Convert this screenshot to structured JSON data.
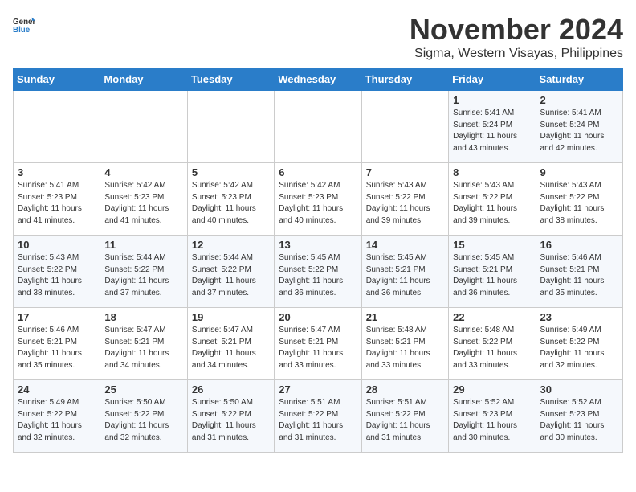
{
  "header": {
    "logo_general": "General",
    "logo_blue": "Blue",
    "month": "November 2024",
    "location": "Sigma, Western Visayas, Philippines"
  },
  "weekdays": [
    "Sunday",
    "Monday",
    "Tuesday",
    "Wednesday",
    "Thursday",
    "Friday",
    "Saturday"
  ],
  "weeks": [
    [
      {
        "day": "",
        "info": ""
      },
      {
        "day": "",
        "info": ""
      },
      {
        "day": "",
        "info": ""
      },
      {
        "day": "",
        "info": ""
      },
      {
        "day": "",
        "info": ""
      },
      {
        "day": "1",
        "info": "Sunrise: 5:41 AM\nSunset: 5:24 PM\nDaylight: 11 hours\nand 43 minutes."
      },
      {
        "day": "2",
        "info": "Sunrise: 5:41 AM\nSunset: 5:24 PM\nDaylight: 11 hours\nand 42 minutes."
      }
    ],
    [
      {
        "day": "3",
        "info": "Sunrise: 5:41 AM\nSunset: 5:23 PM\nDaylight: 11 hours\nand 41 minutes."
      },
      {
        "day": "4",
        "info": "Sunrise: 5:42 AM\nSunset: 5:23 PM\nDaylight: 11 hours\nand 41 minutes."
      },
      {
        "day": "5",
        "info": "Sunrise: 5:42 AM\nSunset: 5:23 PM\nDaylight: 11 hours\nand 40 minutes."
      },
      {
        "day": "6",
        "info": "Sunrise: 5:42 AM\nSunset: 5:23 PM\nDaylight: 11 hours\nand 40 minutes."
      },
      {
        "day": "7",
        "info": "Sunrise: 5:43 AM\nSunset: 5:22 PM\nDaylight: 11 hours\nand 39 minutes."
      },
      {
        "day": "8",
        "info": "Sunrise: 5:43 AM\nSunset: 5:22 PM\nDaylight: 11 hours\nand 39 minutes."
      },
      {
        "day": "9",
        "info": "Sunrise: 5:43 AM\nSunset: 5:22 PM\nDaylight: 11 hours\nand 38 minutes."
      }
    ],
    [
      {
        "day": "10",
        "info": "Sunrise: 5:43 AM\nSunset: 5:22 PM\nDaylight: 11 hours\nand 38 minutes."
      },
      {
        "day": "11",
        "info": "Sunrise: 5:44 AM\nSunset: 5:22 PM\nDaylight: 11 hours\nand 37 minutes."
      },
      {
        "day": "12",
        "info": "Sunrise: 5:44 AM\nSunset: 5:22 PM\nDaylight: 11 hours\nand 37 minutes."
      },
      {
        "day": "13",
        "info": "Sunrise: 5:45 AM\nSunset: 5:22 PM\nDaylight: 11 hours\nand 36 minutes."
      },
      {
        "day": "14",
        "info": "Sunrise: 5:45 AM\nSunset: 5:21 PM\nDaylight: 11 hours\nand 36 minutes."
      },
      {
        "day": "15",
        "info": "Sunrise: 5:45 AM\nSunset: 5:21 PM\nDaylight: 11 hours\nand 36 minutes."
      },
      {
        "day": "16",
        "info": "Sunrise: 5:46 AM\nSunset: 5:21 PM\nDaylight: 11 hours\nand 35 minutes."
      }
    ],
    [
      {
        "day": "17",
        "info": "Sunrise: 5:46 AM\nSunset: 5:21 PM\nDaylight: 11 hours\nand 35 minutes."
      },
      {
        "day": "18",
        "info": "Sunrise: 5:47 AM\nSunset: 5:21 PM\nDaylight: 11 hours\nand 34 minutes."
      },
      {
        "day": "19",
        "info": "Sunrise: 5:47 AM\nSunset: 5:21 PM\nDaylight: 11 hours\nand 34 minutes."
      },
      {
        "day": "20",
        "info": "Sunrise: 5:47 AM\nSunset: 5:21 PM\nDaylight: 11 hours\nand 33 minutes."
      },
      {
        "day": "21",
        "info": "Sunrise: 5:48 AM\nSunset: 5:21 PM\nDaylight: 11 hours\nand 33 minutes."
      },
      {
        "day": "22",
        "info": "Sunrise: 5:48 AM\nSunset: 5:22 PM\nDaylight: 11 hours\nand 33 minutes."
      },
      {
        "day": "23",
        "info": "Sunrise: 5:49 AM\nSunset: 5:22 PM\nDaylight: 11 hours\nand 32 minutes."
      }
    ],
    [
      {
        "day": "24",
        "info": "Sunrise: 5:49 AM\nSunset: 5:22 PM\nDaylight: 11 hours\nand 32 minutes."
      },
      {
        "day": "25",
        "info": "Sunrise: 5:50 AM\nSunset: 5:22 PM\nDaylight: 11 hours\nand 32 minutes."
      },
      {
        "day": "26",
        "info": "Sunrise: 5:50 AM\nSunset: 5:22 PM\nDaylight: 11 hours\nand 31 minutes."
      },
      {
        "day": "27",
        "info": "Sunrise: 5:51 AM\nSunset: 5:22 PM\nDaylight: 11 hours\nand 31 minutes."
      },
      {
        "day": "28",
        "info": "Sunrise: 5:51 AM\nSunset: 5:22 PM\nDaylight: 11 hours\nand 31 minutes."
      },
      {
        "day": "29",
        "info": "Sunrise: 5:52 AM\nSunset: 5:23 PM\nDaylight: 11 hours\nand 30 minutes."
      },
      {
        "day": "30",
        "info": "Sunrise: 5:52 AM\nSunset: 5:23 PM\nDaylight: 11 hours\nand 30 minutes."
      }
    ]
  ]
}
